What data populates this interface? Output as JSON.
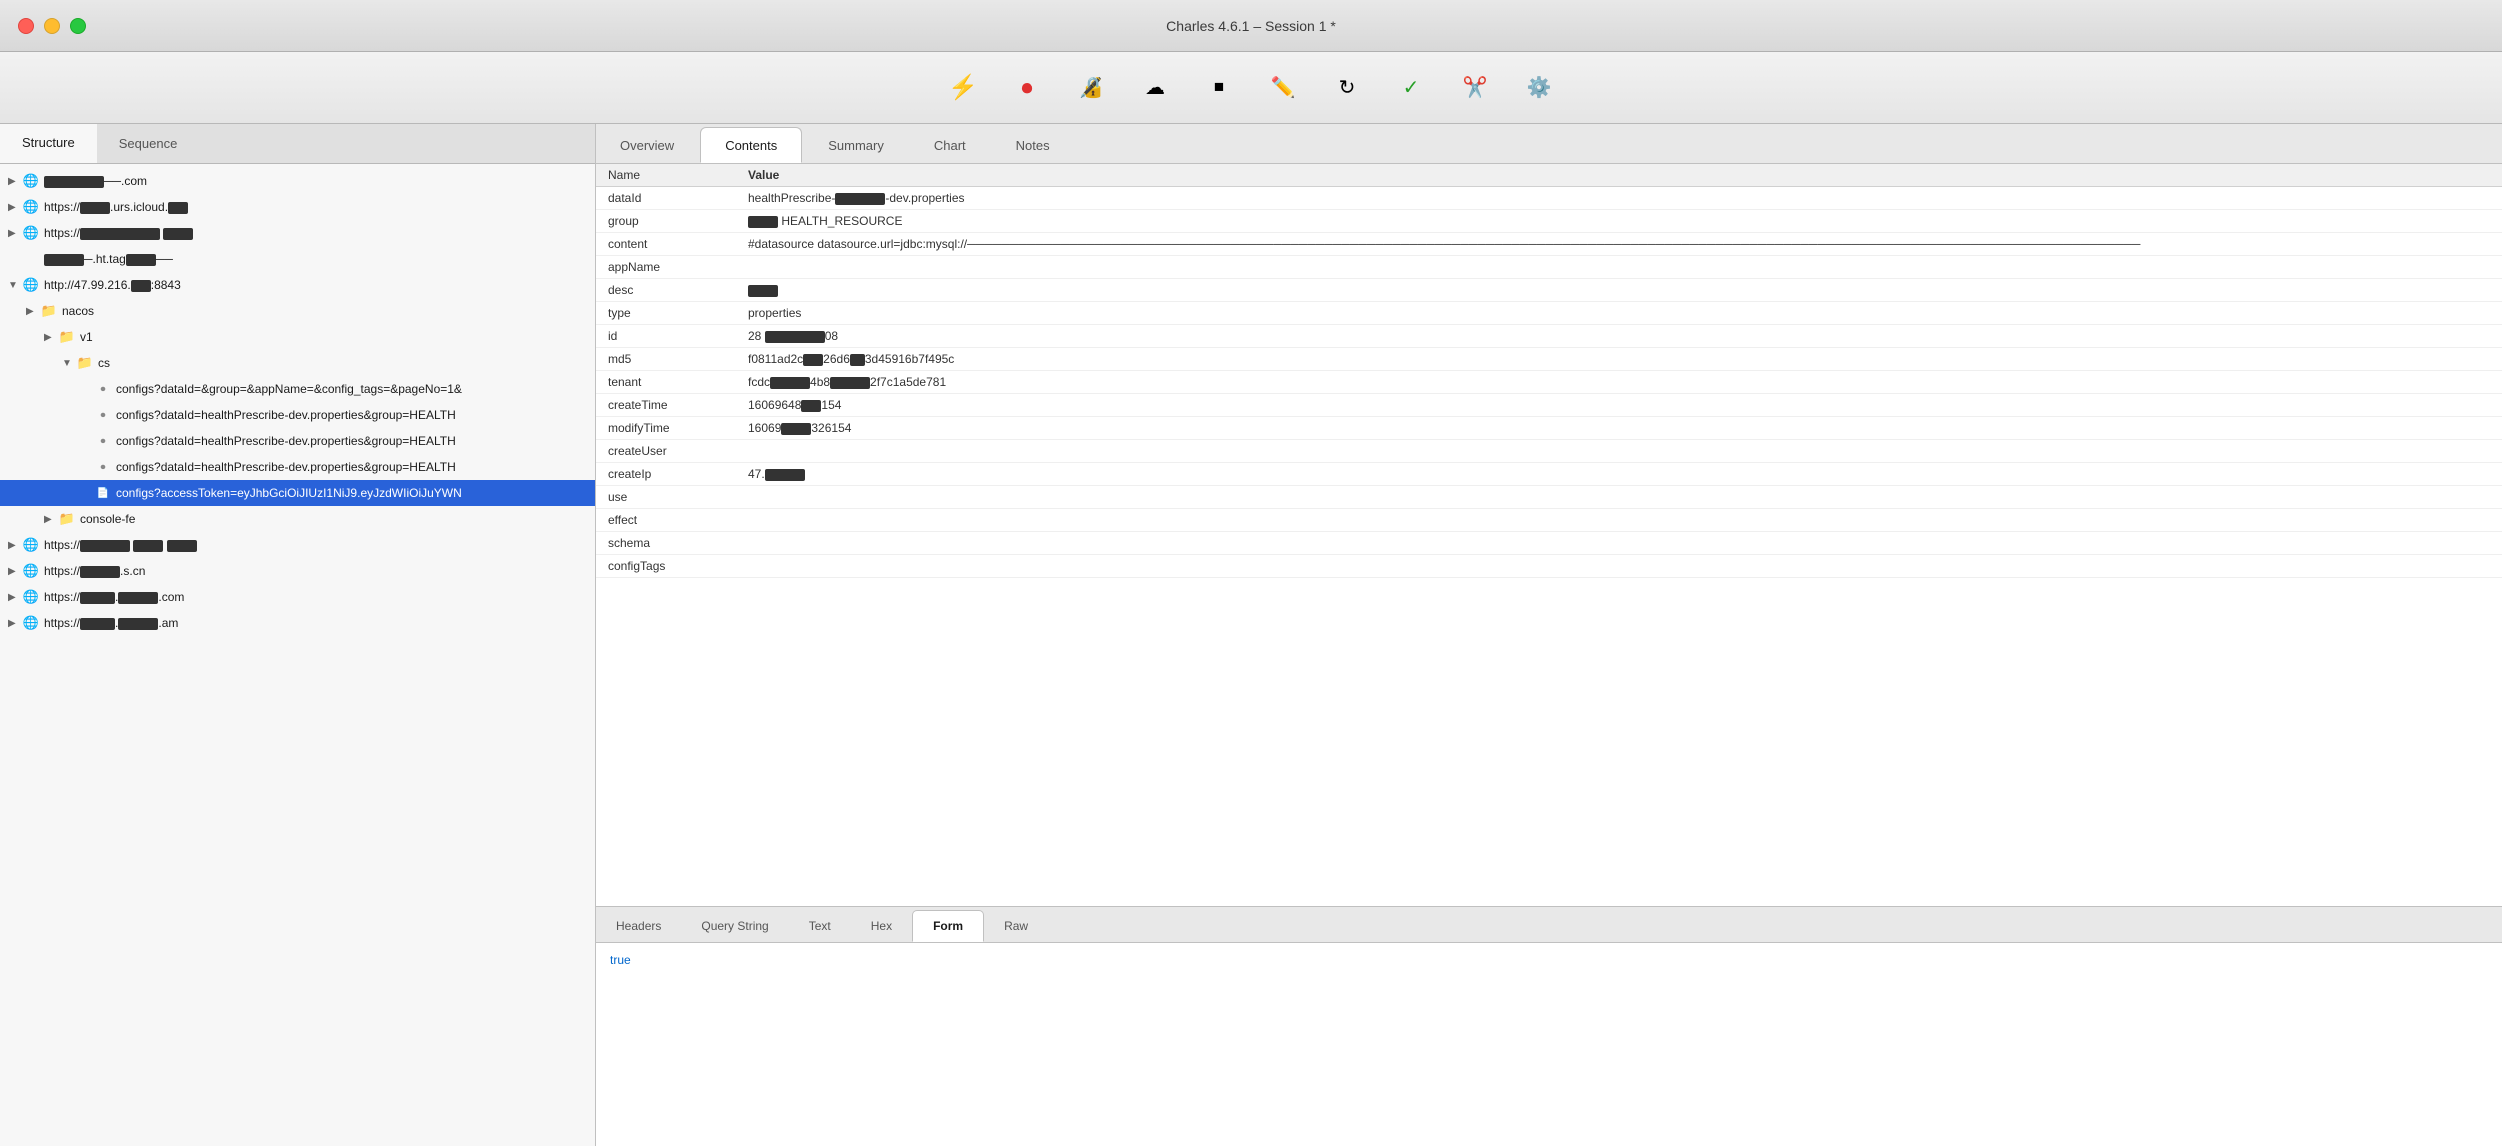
{
  "titlebar": {
    "title": "Charles 4.6.1 – Session 1 *"
  },
  "toolbar": {
    "buttons": [
      {
        "name": "throttle-button",
        "icon": "⚡",
        "label": "Throttle"
      },
      {
        "name": "record-button",
        "icon": "⏺",
        "label": "Record",
        "color": "#e03030"
      },
      {
        "name": "ssl-button",
        "icon": "🔒",
        "label": "SSL"
      },
      {
        "name": "mode-button",
        "icon": "☁",
        "label": "Mode"
      },
      {
        "name": "stop-button",
        "icon": "⏹",
        "label": "Stop"
      },
      {
        "name": "pen-button",
        "icon": "✏",
        "label": "Compose"
      },
      {
        "name": "refresh-button",
        "icon": "↻",
        "label": "Refresh"
      },
      {
        "name": "checkmark-button",
        "icon": "✓",
        "label": "Validate"
      },
      {
        "name": "tools-button",
        "icon": "✂",
        "label": "Tools"
      },
      {
        "name": "settings-button",
        "icon": "⚙",
        "label": "Settings"
      }
    ]
  },
  "left_panel": {
    "tabs": [
      "Structure",
      "Sequence"
    ],
    "active_tab": "Structure",
    "tree_items": [
      {
        "id": "item-1",
        "indent": 0,
        "arrow": "▶",
        "icon": "🌐",
        "label_redacted": true,
        "label": "──────.com",
        "type": "host"
      },
      {
        "id": "item-2",
        "indent": 0,
        "arrow": "▶",
        "icon": "🌐",
        "label": "https://──.urs.icloud.c──",
        "label_redacted": true,
        "type": "host"
      },
      {
        "id": "item-3",
        "indent": 0,
        "arrow": "▶",
        "icon": "🌐",
        "label": "https://──────────────────",
        "label_redacted": true,
        "type": "host"
      },
      {
        "id": "item-4",
        "indent": 0,
        "arrow": "",
        "icon": "",
        "label": "──────.ht.tag──────",
        "label_redacted": true,
        "type": "item"
      },
      {
        "id": "item-5",
        "indent": 0,
        "arrow": "▼",
        "icon": "🌐",
        "label": "http://47.99.216.──:8843",
        "type": "host"
      },
      {
        "id": "item-nacos",
        "indent": 1,
        "arrow": "▶",
        "icon": "📁",
        "label": "nacos",
        "type": "folder"
      },
      {
        "id": "item-v1",
        "indent": 2,
        "arrow": "▶",
        "icon": "📁",
        "label": "v1",
        "type": "folder"
      },
      {
        "id": "item-cs",
        "indent": 3,
        "arrow": "▼",
        "icon": "📁",
        "label": "cs",
        "type": "folder"
      },
      {
        "id": "item-configs-1",
        "indent": 4,
        "arrow": "",
        "icon": "doc",
        "label": "configs?dataId=&group=&appName=&config_tags=&pageNo=1&",
        "type": "request"
      },
      {
        "id": "item-configs-2",
        "indent": 4,
        "arrow": "",
        "icon": "doc",
        "label": "configs?dataId=healthPrescribe-dev.properties&group=HEALTH",
        "type": "request"
      },
      {
        "id": "item-configs-3",
        "indent": 4,
        "arrow": "",
        "icon": "doc",
        "label": "configs?dataId=healthPrescribe-dev.properties&group=HEALTH",
        "type": "request"
      },
      {
        "id": "item-configs-4",
        "indent": 4,
        "arrow": "",
        "icon": "doc",
        "label": "configs?dataId=healthPrescribe-dev.properties&group=HEALTH",
        "type": "request"
      },
      {
        "id": "item-configs-selected",
        "indent": 4,
        "arrow": "",
        "icon": "doc",
        "label": "configs?accessToken=eyJhbGciOiJIUzI1NiJ9.eyJzdWIiOiJuYWN",
        "type": "request",
        "selected": true
      },
      {
        "id": "item-console-fe",
        "indent": 2,
        "arrow": "▶",
        "icon": "📁",
        "label": "console-fe",
        "type": "folder"
      },
      {
        "id": "item-6",
        "indent": 0,
        "arrow": "▶",
        "icon": "🌐",
        "label": "https://──────────────────",
        "label_redacted": true,
        "type": "host"
      },
      {
        "id": "item-7",
        "indent": 0,
        "arrow": "▶",
        "icon": "🌐",
        "label": "https://──────────.s.cn",
        "label_redacted": true,
        "type": "host"
      },
      {
        "id": "item-8",
        "indent": 0,
        "arrow": "▶",
        "icon": "🌐",
        "label": "https://──────.───────.com",
        "label_redacted": true,
        "type": "host"
      },
      {
        "id": "item-9",
        "indent": 0,
        "arrow": "▶",
        "icon": "🌐",
        "label": "https://──────.────────.am",
        "label_redacted": true,
        "type": "host"
      }
    ]
  },
  "right_panel": {
    "top_tabs": [
      "Overview",
      "Contents",
      "Summary",
      "Chart",
      "Notes"
    ],
    "active_top_tab": "Contents",
    "contents_columns": [
      "Name",
      "Value"
    ],
    "contents_rows": [
      {
        "name": "dataId",
        "value": "healthPrescribe-dev.properties",
        "redacted_middle": true
      },
      {
        "name": "group",
        "value": "HEALTH_RESOURCE",
        "redacted_middle": true
      },
      {
        "name": "content",
        "value": "#datasource datasource.url=jdbc:mysql://──────────────────────────────────────────────────────────────────────────────────────────────────────────────────────────────────────────"
      },
      {
        "name": "appName",
        "value": ""
      },
      {
        "name": "desc",
        "value": "████"
      },
      {
        "name": "type",
        "value": "properties"
      },
      {
        "name": "id",
        "value": "28 ██████████████08"
      },
      {
        "name": "md5",
        "value": "f0811ad2c──26d6──3d45916b7f495c"
      },
      {
        "name": "tenant",
        "value": "fcdc──────4b8────────2f7c1a5de781"
      },
      {
        "name": "createTime",
        "value": "16069648──154"
      },
      {
        "name": "modifyTime",
        "value": "16069██████326154"
      },
      {
        "name": "createUser",
        "value": ""
      },
      {
        "name": "createIp",
        "value": "47.──────────"
      },
      {
        "name": "use",
        "value": ""
      },
      {
        "name": "effect",
        "value": ""
      },
      {
        "name": "schema",
        "value": ""
      },
      {
        "name": "configTags",
        "value": ""
      }
    ],
    "bottom_tabs": [
      "Headers",
      "Query String",
      "Text",
      "Hex",
      "Form",
      "Raw"
    ],
    "active_bottom_tab": "Form",
    "bottom_content": "true"
  }
}
